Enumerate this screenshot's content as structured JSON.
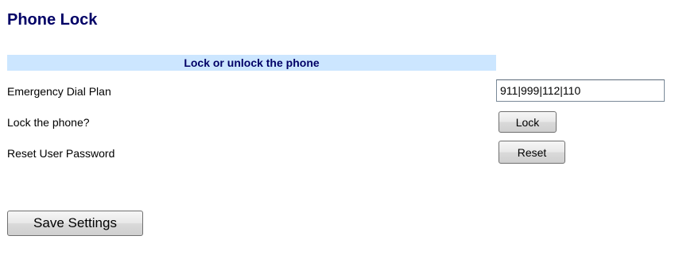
{
  "page": {
    "title": "Phone Lock"
  },
  "section": {
    "header": "Lock or unlock the phone"
  },
  "rows": [
    {
      "label": "Emergency Dial Plan",
      "control": "text-input",
      "value": "911|999|112|110"
    },
    {
      "label": "Lock the phone?",
      "control": "button",
      "button_label": "Lock"
    },
    {
      "label": "Reset User Password",
      "control": "button",
      "button_label": "Reset"
    }
  ],
  "actions": {
    "save_label": "Save Settings"
  },
  "colors": {
    "title_text": "#000066",
    "section_header_background": "#cce6ff",
    "page_background": "#ffffff"
  }
}
